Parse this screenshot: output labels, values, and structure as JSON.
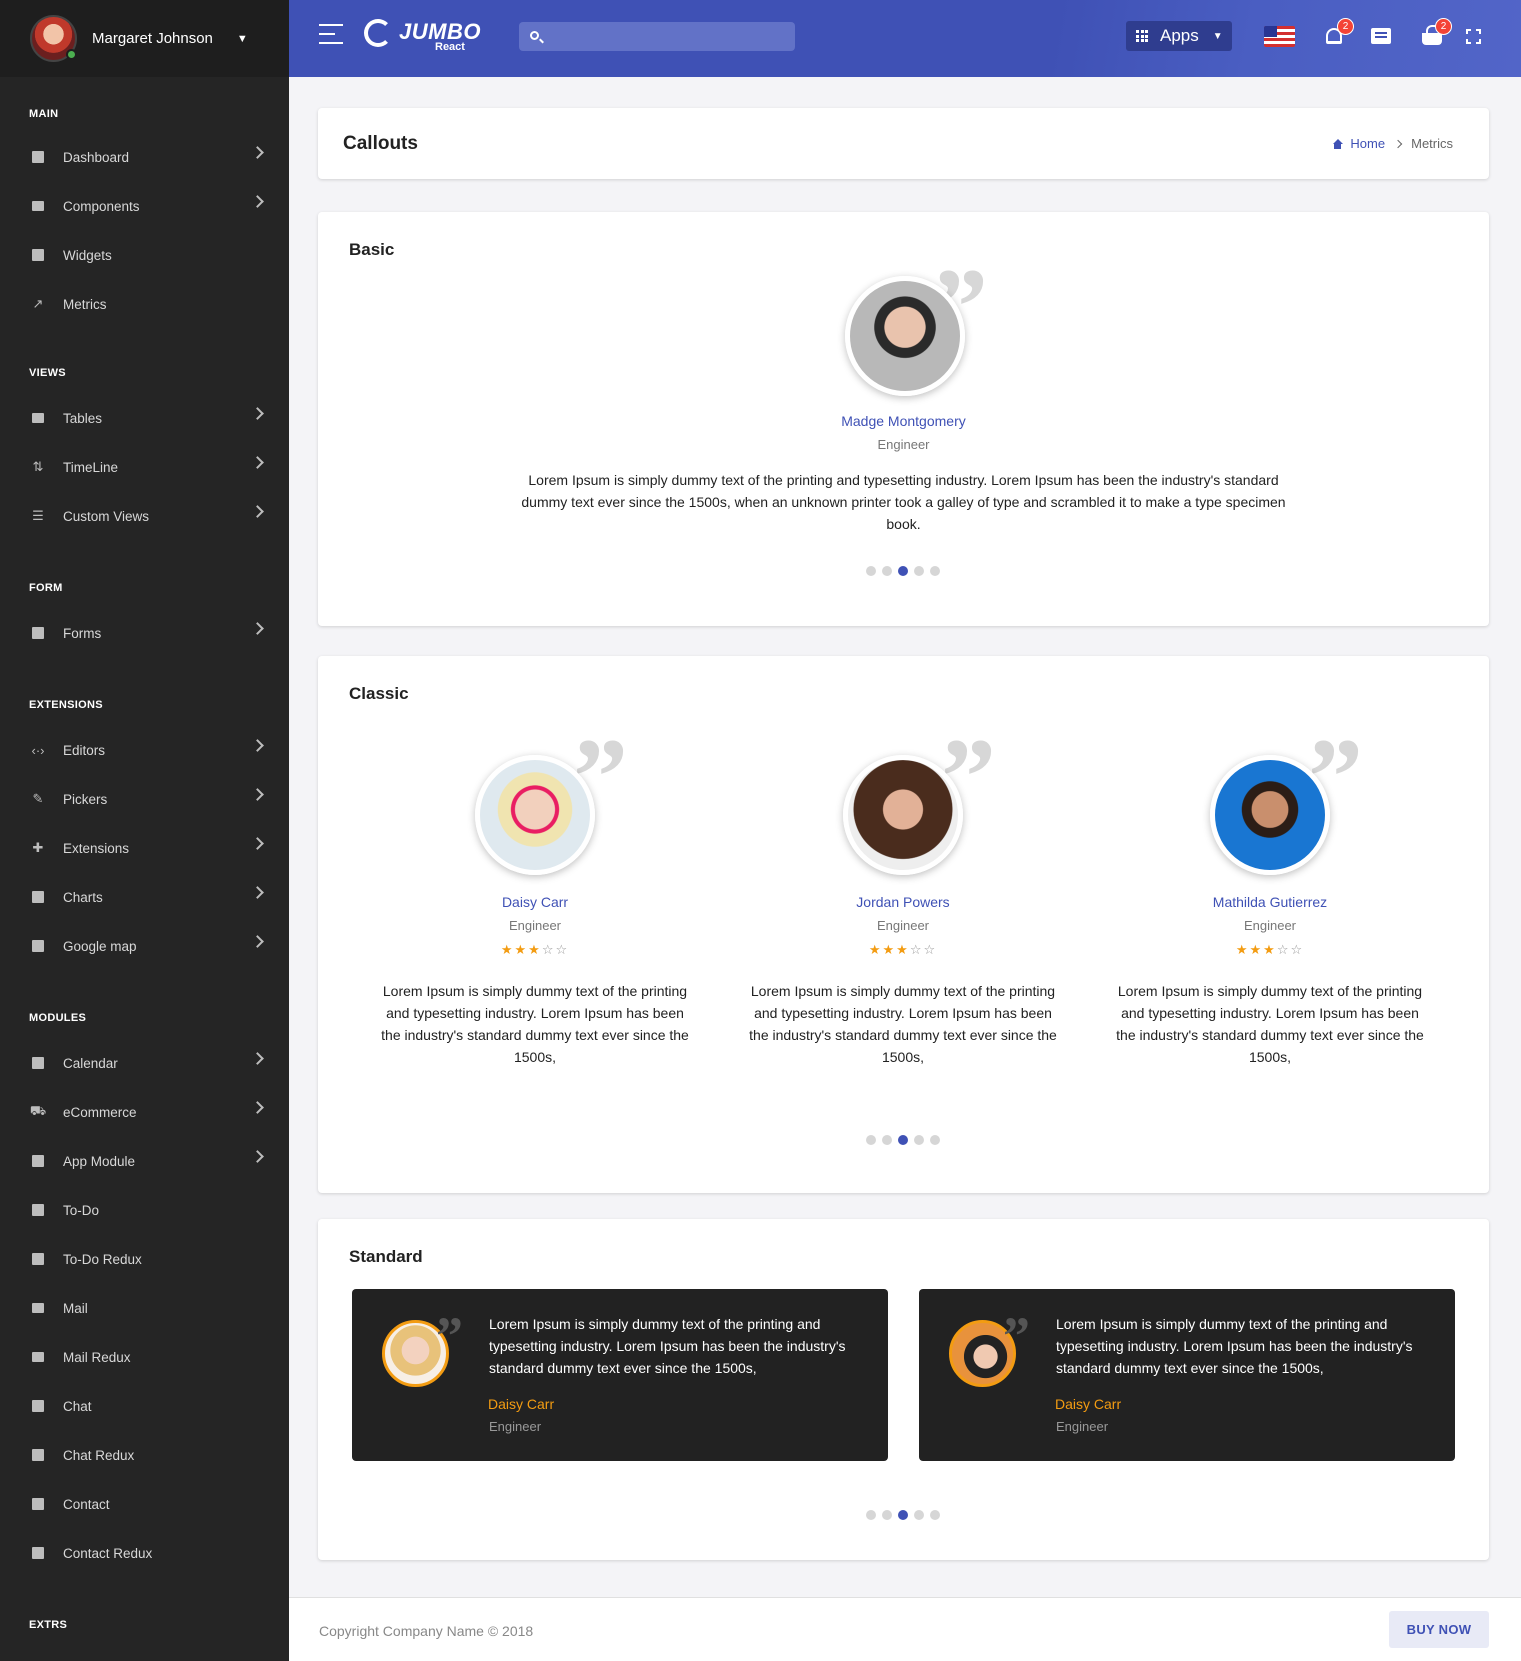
{
  "sidebar": {
    "user_name": "Margaret Johnson",
    "sections": {
      "main": "MAIN",
      "views": "VIEWS",
      "form": "FORM",
      "extensions": "EXTENSIONS",
      "modules": "MODULES",
      "extras": "EXTRS"
    },
    "items": {
      "dashboard": "Dashboard",
      "components": "Components",
      "widgets": "Widgets",
      "metrics": "Metrics",
      "tables": "Tables",
      "timeline": "TimeLine",
      "custom_views": "Custom Views",
      "forms": "Forms",
      "editors": "Editors",
      "pickers": "Pickers",
      "extensions": "Extensions",
      "charts": "Charts",
      "google_map": "Google map",
      "calendar": "Calendar",
      "ecommerce": "eCommerce",
      "app_module": "App Module",
      "todo": "To-Do",
      "todo_redux": "To-Do Redux",
      "mail": "Mail",
      "mail_redux": "Mail Redux",
      "chat": "Chat",
      "chat_redux": "Chat Redux",
      "contact": "Contact",
      "contact_redux": "Contact Redux"
    }
  },
  "header": {
    "logo_text": "JUMBO",
    "logo_sub": "React",
    "search_placeholder": "",
    "apps_label": "Apps",
    "notifications_count": "2",
    "cart_count": "2"
  },
  "page": {
    "title": "Callouts",
    "breadcrumb_home": "Home",
    "breadcrumb_current": "Metrics"
  },
  "basic": {
    "title": "Basic",
    "name": "Madge Montgomery",
    "role": "Engineer",
    "text": "Lorem Ipsum is simply dummy text of the printing and typesetting industry. Lorem Ipsum has been the industry's standard dummy text ever since the 1500s, when an unknown printer took a galley of type and scrambled it to make a type specimen book.",
    "active_slide": 3,
    "slide_count": 5
  },
  "classic": {
    "title": "Classic",
    "cards": [
      {
        "name": "Daisy Carr",
        "role": "Engineer",
        "rating": 3,
        "max_rating": 5,
        "text": "Lorem Ipsum is simply dummy text of the printing and typesetting industry. Lorem Ipsum has been the industry's standard dummy text ever since the 1500s,"
      },
      {
        "name": "Jordan Powers",
        "role": "Engineer",
        "rating": 3,
        "max_rating": 5,
        "text": "Lorem Ipsum is simply dummy text of the printing and typesetting industry. Lorem Ipsum has been the industry's standard dummy text ever since the 1500s,"
      },
      {
        "name": "Mathilda Gutierrez",
        "role": "Engineer",
        "rating": 3,
        "max_rating": 5,
        "text": "Lorem Ipsum is simply dummy text of the printing and typesetting industry. Lorem Ipsum has been the industry's standard dummy text ever since the 1500s,"
      }
    ],
    "active_slide": 3,
    "slide_count": 5
  },
  "standard": {
    "title": "Standard",
    "cards": [
      {
        "name": "Daisy Carr",
        "role": "Engineer",
        "text": "Lorem Ipsum is simply dummy text of the printing and typesetting industry. Lorem Ipsum has been the industry's standard dummy text ever since the 1500s,"
      },
      {
        "name": "Daisy Carr",
        "role": "Engineer",
        "text": "Lorem Ipsum is simply dummy text of the printing and typesetting industry. Lorem Ipsum has been the industry's standard dummy text ever since the 1500s,"
      }
    ],
    "active_slide": 3,
    "slide_count": 5
  },
  "footer": {
    "copyright": "Copyright Company Name © 2018",
    "buy_now": "BUY NOW"
  },
  "colors": {
    "primary": "#3f51b5",
    "sidebar_bg": "#252525",
    "accent": "#f39c12",
    "badge": "#f44336"
  }
}
